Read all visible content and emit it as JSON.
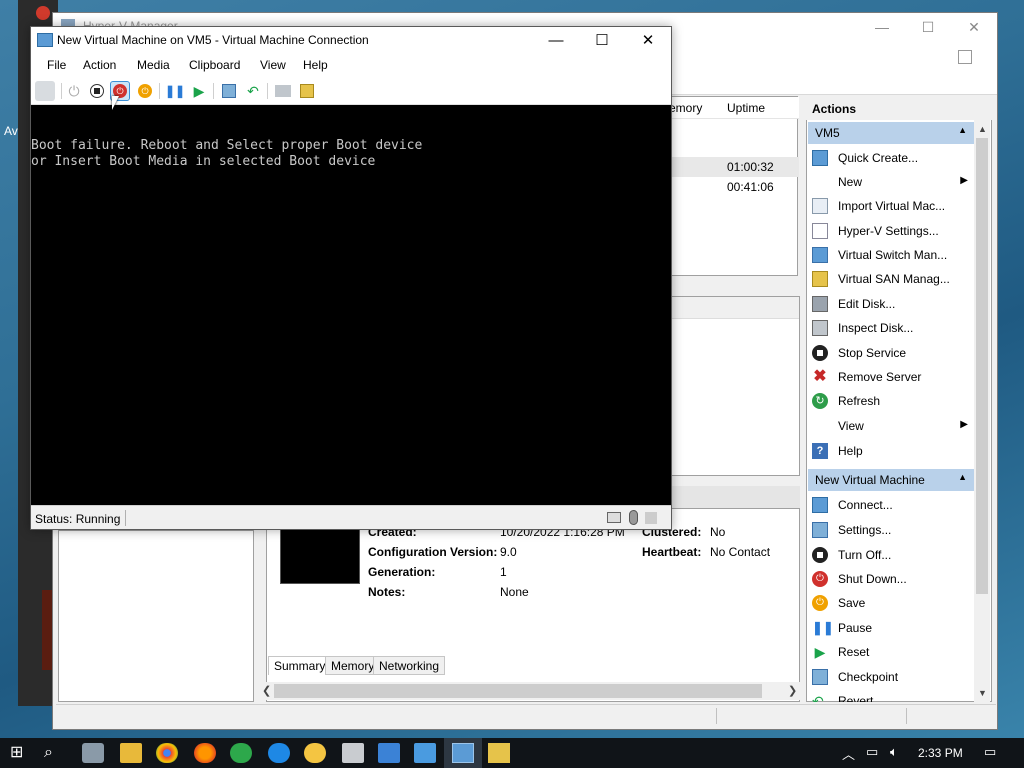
{
  "desktop": {
    "partial_label": "Av"
  },
  "hyperv_manager": {
    "title": "Hyper-V Manager",
    "vm_columns": [
      "emory",
      "Uptime"
    ],
    "vm_uptimes": [
      "01:00:32",
      "00:41:06"
    ],
    "details": {
      "created_label": "Created:",
      "created_value": "10/20/2022 1:16:28 PM",
      "config_version_label": "Configuration Version:",
      "config_version_value": "9.0",
      "generation_label": "Generation:",
      "generation_value": "1",
      "notes_label": "Notes:",
      "notes_value": "None",
      "clustered_label": "Clustered:",
      "clustered_value": "No",
      "heartbeat_label": "Heartbeat:",
      "heartbeat_value": "No Contact"
    },
    "tabs": [
      "Summary",
      "Memory",
      "Networking"
    ],
    "actions": {
      "title": "Actions",
      "host_section": "VM5",
      "host_items": [
        {
          "label": "Quick Create...",
          "icon": "quick-create-icon"
        },
        {
          "label": "New",
          "icon": "none",
          "submenu": true
        },
        {
          "label": "Import Virtual Mac...",
          "icon": "import-icon"
        },
        {
          "label": "Hyper-V Settings...",
          "icon": "settings-doc-icon"
        },
        {
          "label": "Virtual Switch Man...",
          "icon": "switch-icon"
        },
        {
          "label": "Virtual SAN Manag...",
          "icon": "san-icon"
        },
        {
          "label": "Edit Disk...",
          "icon": "edit-disk-icon"
        },
        {
          "label": "Inspect Disk...",
          "icon": "inspect-disk-icon"
        },
        {
          "label": "Stop Service",
          "icon": "stop-icon"
        },
        {
          "label": "Remove Server",
          "icon": "remove-icon"
        },
        {
          "label": "Refresh",
          "icon": "refresh-icon"
        },
        {
          "label": "View",
          "icon": "none",
          "submenu": true
        },
        {
          "label": "Help",
          "icon": "help-icon"
        }
      ],
      "vm_section": "New Virtual Machine",
      "vm_items": [
        {
          "label": "Connect...",
          "icon": "connect-icon"
        },
        {
          "label": "Settings...",
          "icon": "settings-icon"
        },
        {
          "label": "Turn Off...",
          "icon": "turn-off-icon"
        },
        {
          "label": "Shut Down...",
          "icon": "shutdown-icon"
        },
        {
          "label": "Save",
          "icon": "save-icon"
        },
        {
          "label": "Pause",
          "icon": "pause-icon"
        },
        {
          "label": "Reset",
          "icon": "reset-icon"
        },
        {
          "label": "Checkpoint",
          "icon": "checkpoint-icon"
        },
        {
          "label": "Revert...",
          "icon": "revert-icon"
        }
      ]
    }
  },
  "vm_connection": {
    "title": "New Virtual Machine on VM5 - Virtual Machine Connection",
    "menu": [
      "File",
      "Action",
      "Media",
      "Clipboard",
      "View",
      "Help"
    ],
    "screen_lines": [
      "Boot failure. Reboot and Select proper Boot device",
      "or Insert Boot Media in selected Boot device"
    ],
    "status": "Status: Running"
  },
  "taskbar": {
    "time": "2:33 PM"
  },
  "colors": {
    "section_bg": "#b9d1ea",
    "shutdown_red": "#d0312d",
    "save_orange": "#f0a100",
    "pause_blue": "#2a7bd6",
    "play_green": "#1aa34a",
    "taskbar": "#101418"
  }
}
